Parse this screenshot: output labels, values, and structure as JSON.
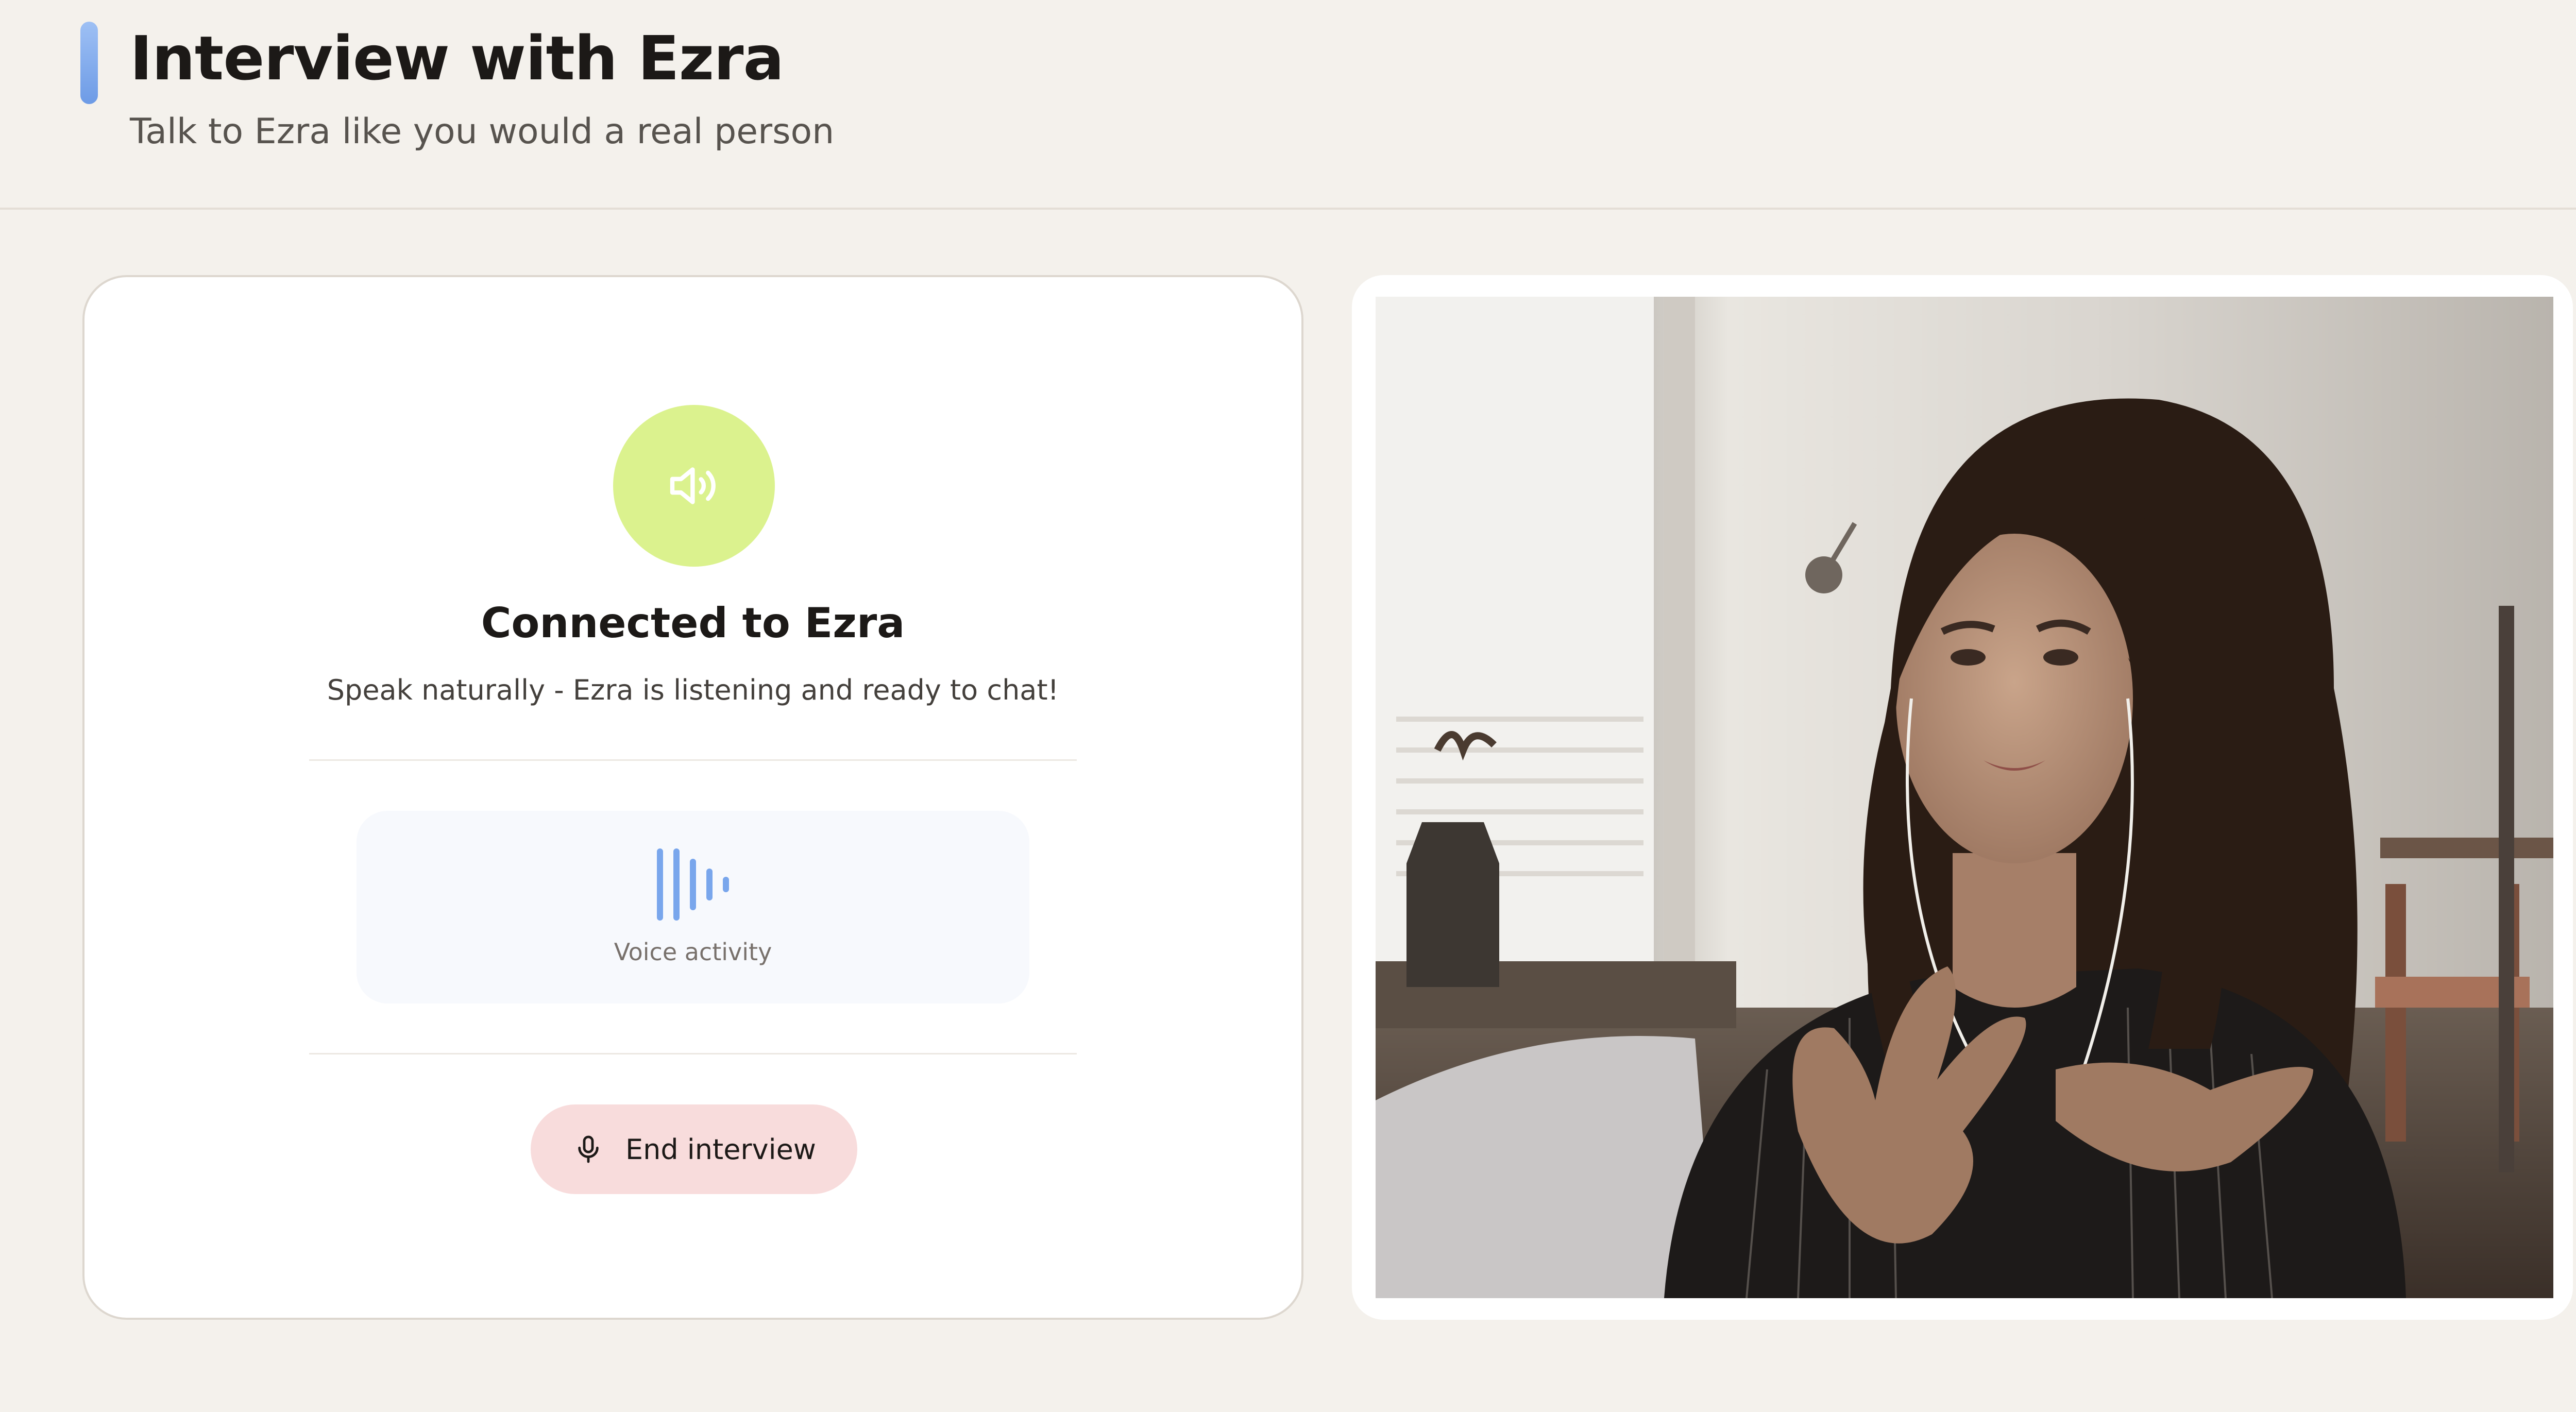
{
  "header": {
    "title": "Interview with Ezra",
    "subtitle": "Talk to Ezra like you would a real person"
  },
  "status_card": {
    "icon": "speaker-icon",
    "title": "Connected to Ezra",
    "message": "Speak naturally - Ezra is listening and ready to chat!",
    "voice_activity": {
      "icon": "sound-wave-icon",
      "label": "Voice activity"
    },
    "end_button": {
      "icon": "microphone-icon",
      "label": "End interview"
    }
  },
  "video": {
    "subject": "video feed of Ezra"
  },
  "colors": {
    "page_background": "#f4f1ec",
    "accent_gradient_top": "#9ec0f4",
    "accent_gradient_bottom": "#6d9be6",
    "speaker_circle": "#dbf28e",
    "voice_bars": "#79a6ec",
    "end_button_background": "#f8dcdc"
  }
}
